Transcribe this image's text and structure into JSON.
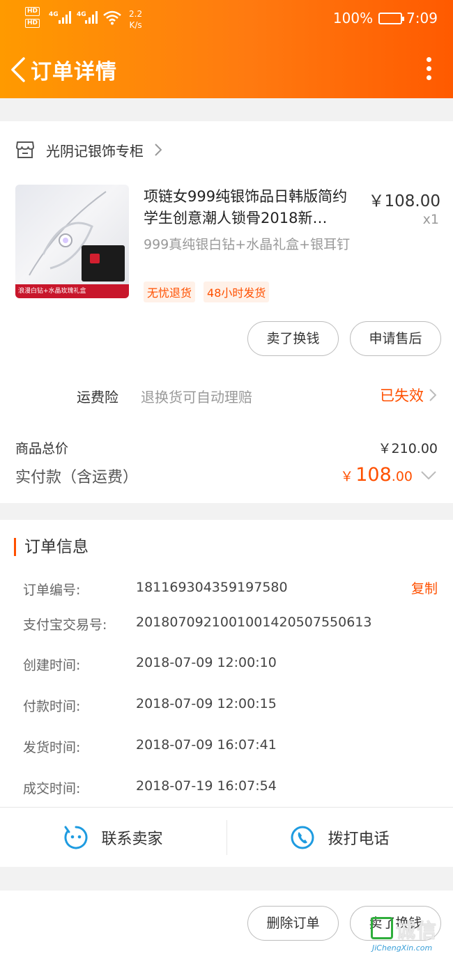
{
  "status_bar": {
    "network_1": "4G",
    "network_2": "4G",
    "speed_value": "2.2",
    "speed_unit": "K/s",
    "battery": "100%",
    "time": "7:09"
  },
  "nav": {
    "title": "订单详情"
  },
  "shop": {
    "name": "光阴记银饰专柜"
  },
  "product": {
    "title": "项链女999纯银饰品日韩版简约学生创意潮人锁骨2018新…",
    "price": "￥108.00",
    "qty": "x1",
    "sku": "999真纯银白钻+水晶礼盒+银耳钉",
    "image_caption": "浪漫白钻+水晶玫瑰礼盒",
    "tags": [
      "无忧退货",
      "48小时发货"
    ]
  },
  "item_actions": {
    "sell": "卖了换钱",
    "aftersale": "申请售后"
  },
  "insurance": {
    "label": "运费险",
    "desc": "退换货可自动理赔",
    "status": "已失效"
  },
  "totals": {
    "goods_label": "商品总价",
    "goods_value": "￥210.00",
    "paid_label": "实付款（含运费）",
    "paid_currency": "￥",
    "paid_int": "108",
    "paid_dec": ".00"
  },
  "order_info": {
    "title": "订单信息",
    "copy": "复制",
    "rows": [
      {
        "label": "订单编号:",
        "value": "181169304359197580"
      },
      {
        "label": "支付宝交易号:",
        "value": "2018070921001001420507550613"
      },
      {
        "label": "创建时间:",
        "value": "2018-07-09 12:00:10"
      },
      {
        "label": "付款时间:",
        "value": "2018-07-09 12:00:15"
      },
      {
        "label": "发货时间:",
        "value": "2018-07-09 16:07:41"
      },
      {
        "label": "成交时间:",
        "value": "2018-07-19 16:07:54"
      }
    ]
  },
  "contact": {
    "seller": "联系卖家",
    "call": "拨打电话"
  },
  "bottom_actions": {
    "delete": "删除订单",
    "sell": "卖了换钱"
  },
  "watermark": {
    "cn": "诚信",
    "en": "JiChengXin.com"
  },
  "colors": {
    "accent": "#ff5000",
    "header_start": "#ff9a00",
    "header_end": "#ff5a00",
    "icon_blue": "#1e9be0"
  },
  "icons": [
    "back-arrow-icon",
    "more-dots-icon",
    "store-icon",
    "chevron-right-icon",
    "chevron-down-icon",
    "chat-face-icon",
    "phone-icon"
  ]
}
